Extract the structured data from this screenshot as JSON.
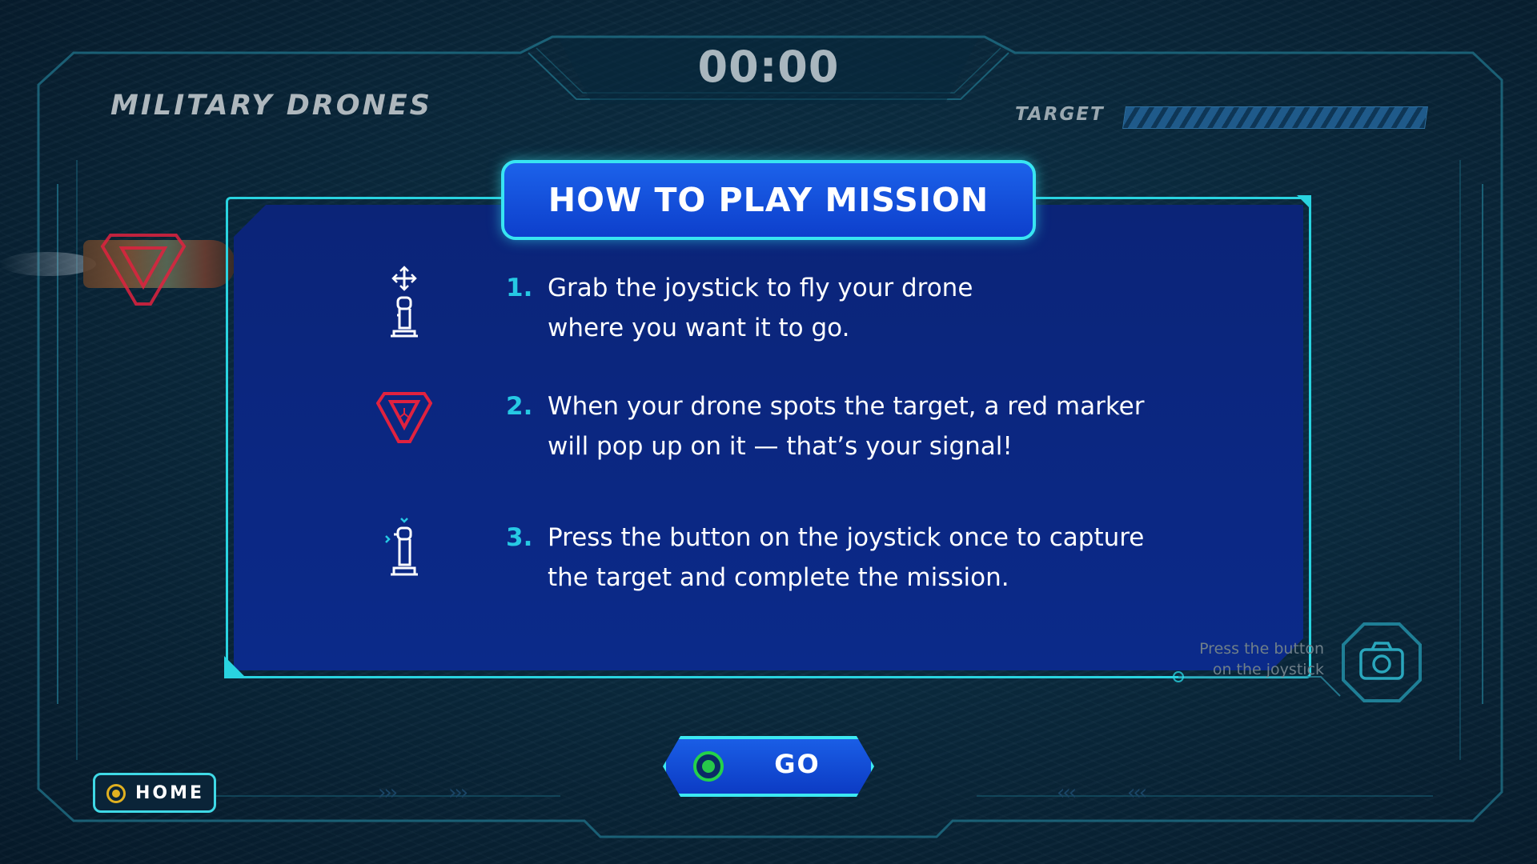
{
  "hud": {
    "timer": "00:00",
    "game_title": "MILITARY DRONES",
    "target_label": "TARGET",
    "target_progress": 0.0
  },
  "dialog": {
    "title": "HOW TO PLAY MISSION",
    "steps": [
      {
        "number": "1.",
        "line1": "Grab the joystick to fly your drone",
        "line2": "where you want it to go.",
        "icon": "joystick-move-icon"
      },
      {
        "number": "2.",
        "line1": "When your drone spots the target, a red marker",
        "line2": "will pop up on it — that’s your signal!",
        "icon": "target-marker-icon"
      },
      {
        "number": "3.",
        "line1": "Press the button on the joystick once to capture",
        "line2": "the target and complete the mission.",
        "icon": "joystick-press-icon"
      }
    ]
  },
  "camera_hint": {
    "line1": "Press the button",
    "line2": "on the joystick",
    "icon": "camera-icon"
  },
  "buttons": {
    "go": "GO",
    "home": "HOME"
  },
  "colors": {
    "accent": "#29d3e0",
    "panel": "#0b2a8a",
    "header": "#1c62ea",
    "marker": "#e0223f",
    "go_indicator": "#27c94a",
    "home_indicator": "#e0b020"
  }
}
